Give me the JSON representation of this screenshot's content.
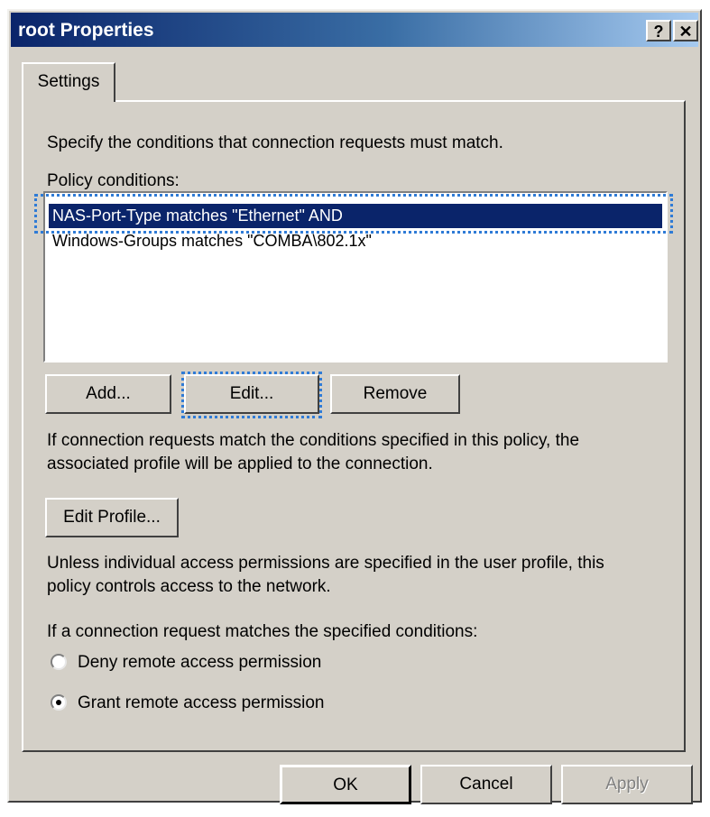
{
  "window": {
    "title": "root Properties",
    "help_button": "?",
    "close_button": "✕"
  },
  "tabs": [
    {
      "label": "Settings",
      "active": true
    }
  ],
  "settings": {
    "intro": "Specify the conditions that connection requests must match.",
    "policy_conditions_label": "Policy conditions:",
    "conditions": [
      "NAS-Port-Type matches \"Ethernet\" AND",
      "Windows-Groups matches \"COMBA\\802.1x\""
    ],
    "selected_index": 0,
    "add_button": "Add...",
    "edit_button": "Edit...",
    "remove_button": "Remove",
    "match_note_line1": "If connection requests match the conditions specified in this policy, the",
    "match_note_line2": "associated profile will be applied to the connection.",
    "edit_profile_button": "Edit Profile...",
    "permissions_note_line1": "Unless individual access permissions are specified in the user profile, this",
    "permissions_note_line2": "policy controls access to the network.",
    "if_match_label": "If a connection request matches the specified conditions:",
    "deny_option": "Deny remote access permission",
    "grant_option": "Grant remote access permission",
    "selected_option": "grant"
  },
  "footer": {
    "ok_button": "OK",
    "cancel_button": "Cancel",
    "apply_button": "Apply"
  },
  "colors": {
    "face": "#d4d0c8",
    "title_start": "#0a246a",
    "title_end": "#a6caf0",
    "selection": "#0a246a",
    "focus_dots": "#2f7bd6"
  }
}
